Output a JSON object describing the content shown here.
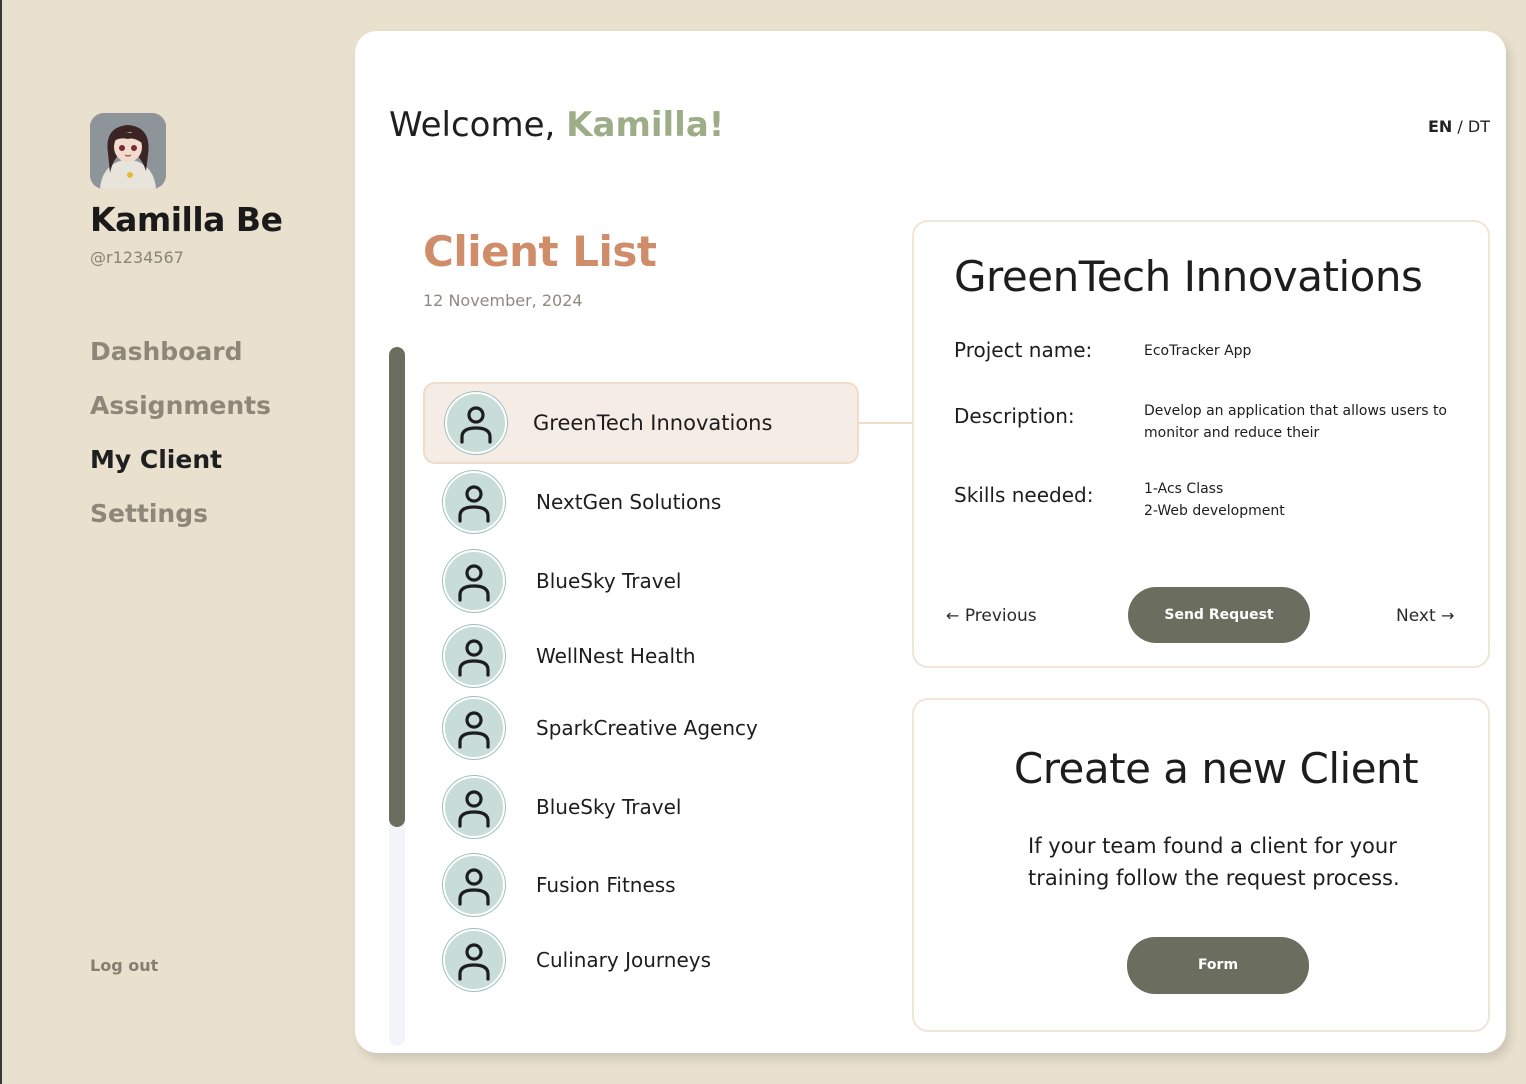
{
  "user": {
    "name": "Kamilla Be",
    "handle": "@r1234567"
  },
  "sidebar": {
    "items": [
      {
        "label": "Dashboard",
        "active": false
      },
      {
        "label": "Assignments",
        "active": false
      },
      {
        "label": "My Client",
        "active": true
      },
      {
        "label": "Settings",
        "active": false
      }
    ],
    "logout": "Log out"
  },
  "header": {
    "welcome_prefix": "Welcome,",
    "welcome_name": "Kamilla!",
    "lang_en": "EN",
    "lang_sep": "/",
    "lang_dt": "DT"
  },
  "client_list": {
    "title": "Client List",
    "date": "12 November, 2024",
    "clients": [
      {
        "name": "GreenTech Innovations",
        "selected": true
      },
      {
        "name": "NextGen Solutions"
      },
      {
        "name": "BlueSky Travel"
      },
      {
        "name": "WellNest Health"
      },
      {
        "name": "SparkCreative Agency"
      },
      {
        "name": "BlueSky Travel"
      },
      {
        "name": "Fusion Fitness"
      },
      {
        "name": "Culinary Journeys"
      }
    ]
  },
  "detail": {
    "title": "GreenTech Innovations",
    "project_label": "Project name:",
    "project_value": "EcoTracker App",
    "description_label": "Description:",
    "description_value": "Develop an application that allows users to monitor and reduce their",
    "skills_label": "Skills needed:",
    "skills": [
      "1-Acs Class",
      "2-Web development"
    ],
    "previous": "Previous",
    "next": "Next",
    "send_request": "Send Request"
  },
  "create": {
    "title": "Create a new Client",
    "description": "If your team found a client for your training follow the request process.",
    "form_button": "Form"
  },
  "colors": {
    "background": "#e9e0cd",
    "accent_green": "#9cad87",
    "accent_orange": "#d08d6a",
    "button": "#6b6e5f"
  }
}
